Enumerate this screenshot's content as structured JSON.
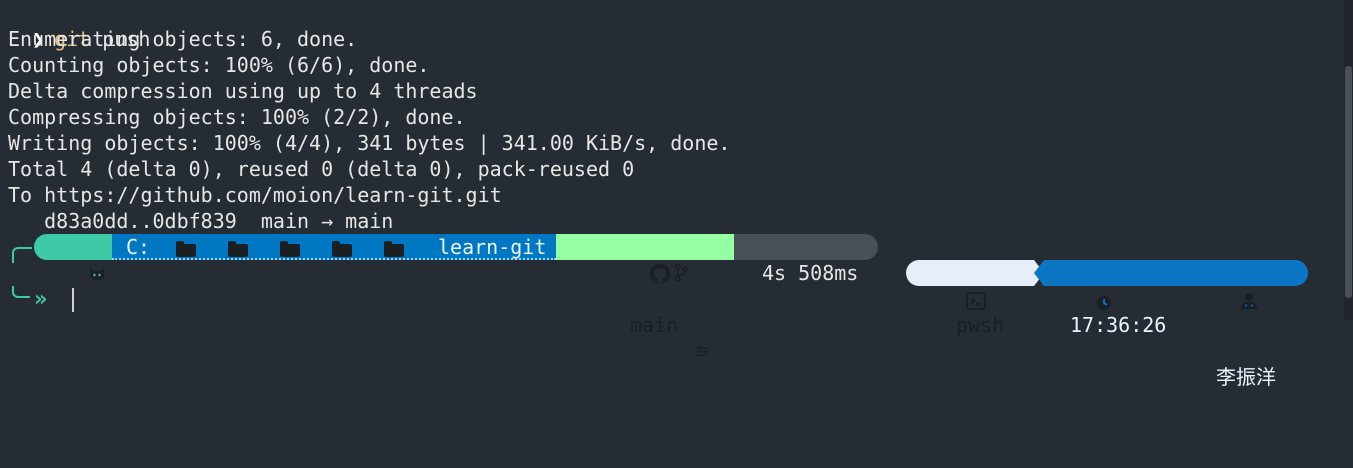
{
  "command": {
    "prompt_glyph": "❯",
    "program": "git",
    "args": " push"
  },
  "output_lines": [
    "Enumerating objects: 6, done.",
    "Counting objects: 100% (6/6), done.",
    "Delta compression using up to 4 threads",
    "Compressing objects: 100% (2/2), done.",
    "Writing objects: 100% (4/4), 341 bytes | 341.00 KiB/s, done.",
    "Total 4 (delta 0), reused 0 (delta 0), pack-reused 0",
    "To https://github.com/moion/learn-git.git",
    "   d83a0dd..0dbf839  main → main"
  ],
  "prompt": {
    "os_icon": "cat-icon",
    "path": {
      "drive": "C:",
      "folders_icon": "folder-icon",
      "current": "learn-git"
    },
    "git": {
      "icons": [
        "github-icon",
        "branch-icon"
      ],
      "branch": "main",
      "status": "≡"
    },
    "execution_time": "4s 508ms",
    "shell": {
      "icon": "terminal-icon",
      "name": "pwsh"
    },
    "clock": {
      "icon": "clock-icon",
      "time": "17:36:26"
    },
    "user": {
      "icon": "user-icon",
      "name": "李振洋"
    },
    "input_glyph": "»"
  },
  "colors": {
    "background": "#262c33",
    "os_segment": "#3ec9a7",
    "path_segment": "#0077c2",
    "git_segment": "#95ffa4",
    "time_segment": "#494f57",
    "shell_segment": "#e6eef7",
    "clock_segment": "#0a76c4"
  }
}
